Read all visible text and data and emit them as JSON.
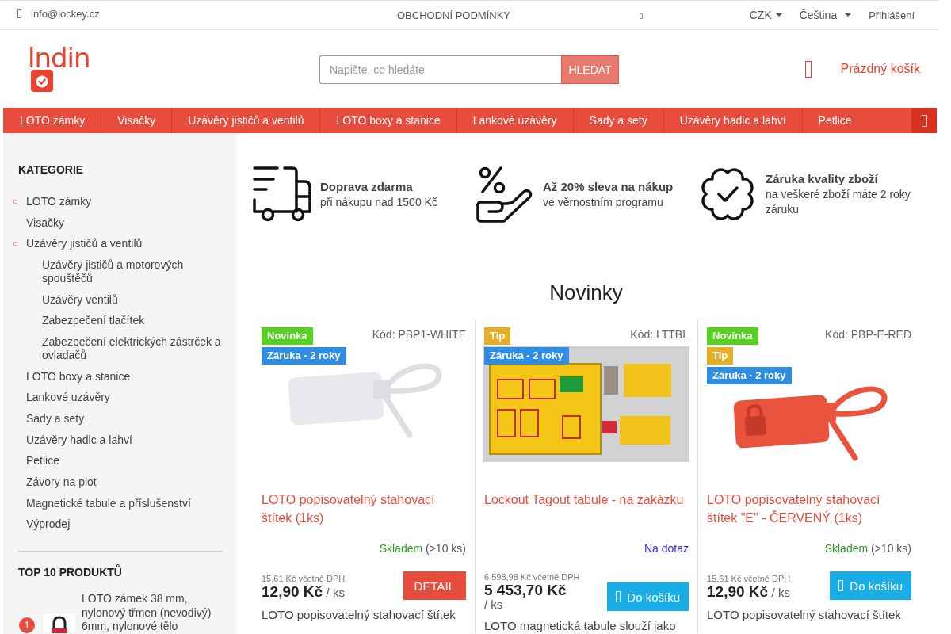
{
  "top_bar": {
    "email": "info@lockey.cz",
    "terms": "OBCHODNÍ PODMÍNKY",
    "currency": "CZK",
    "language": "Čeština",
    "login": "Přihlášení"
  },
  "header": {
    "logo": "lndin",
    "search": {
      "placeholder": "Napište, co hledáte",
      "button": "HLEDAT"
    },
    "cart": "Prázdný košík"
  },
  "nav": {
    "items": [
      "LOTO zámky",
      "Visačky",
      "Uzávěry jističů a ventilů",
      "LOTO boxy a stanice",
      "Lankové uzávěry",
      "Sady a sety",
      "Uzávěry hadic a lahví",
      "Petlice"
    ]
  },
  "sidebar": {
    "categories": {
      "title": "KATEGORIE",
      "items": [
        {
          "label": "LOTO zámky",
          "expandable": true
        },
        {
          "label": "Visačky",
          "expandable": false
        },
        {
          "label": "Uzávěry jističů a ventilů",
          "expandable": true,
          "children": [
            {
              "label": "Uzávěry jističů a motorových spouštěčů",
              "expandable": false
            },
            {
              "label": "Uzávěry ventilů",
              "expandable": false
            },
            {
              "label": "Zabezpečení tlačítek",
              "expandable": false
            },
            {
              "label": "Zabezpečení elektrických zástrček a ovladačů",
              "expandable": false
            }
          ]
        },
        {
          "label": "LOTO boxy a stanice",
          "expandable": false
        },
        {
          "label": "Lankové uzávěry",
          "expandable": false
        },
        {
          "label": "Sady a sety",
          "expandable": false
        },
        {
          "label": "Uzávěry hadic a lahví",
          "expandable": false
        },
        {
          "label": "Petlice",
          "expandable": false
        },
        {
          "label": "Závory na plot",
          "expandable": false
        },
        {
          "label": "Magnetické tabule a příslušenství",
          "expandable": false
        },
        {
          "label": "Výprodej",
          "expandable": false
        }
      ]
    },
    "top_products": {
      "title": "TOP 10 PRODUKTŮ",
      "items": [
        {
          "rank": "1",
          "name": "LOTO zámek 38 mm, nylonový třmen (nevodivý) 6mm, nylonové tělo"
        }
      ]
    }
  },
  "benefits": [
    {
      "kind": "truck",
      "title": "Doprava zdarma",
      "text": "při nákupu nad 1500 Kč"
    },
    {
      "kind": "discount",
      "title": "Až 20% sleva na nákup",
      "text": "ve věrnostním programu"
    },
    {
      "kind": "quality",
      "title": "Záruka kvality zboží",
      "text": "na veškeré zboží máte 2 roky záruku"
    }
  ],
  "new_products": {
    "title": "Novinky",
    "products": [
      {
        "kind": "whitetag",
        "badges": [
          {
            "kind": "new",
            "label": "Novinka"
          },
          {
            "kind": "warranty",
            "label": "Záruka - 2 roky"
          }
        ],
        "code": "Kód: PBP1-WHITE",
        "name": "LOTO popisovatelný stahovací štítek (1ks)",
        "stock": {
          "kind": "in_stock",
          "label": "Skladem",
          "quantity": "(>10 ks)"
        },
        "price_with_vat": "15,61 Kč včetně DPH",
        "price": "12,90 Kč",
        "unit": "/ ks",
        "button": {
          "kind": "detail",
          "label": "DETAIL"
        },
        "description": "LOTO popisovatelný stahovací štítek"
      },
      {
        "kind": "board",
        "badges": [
          {
            "kind": "tip",
            "label": "Tip"
          },
          {
            "kind": "warranty",
            "label": "Záruka - 2 roky"
          }
        ],
        "code": "Kód: LTTBL",
        "name": "Lockout Tagout tabule - na zakázku",
        "stock": {
          "kind": "on_request",
          "label": "Na dotaz"
        },
        "price_with_vat": "6 598,98 Kč včetně DPH",
        "price": "5 453,70 Kč",
        "unit": "/ ks",
        "button": {
          "kind": "cart",
          "label": "Do košíku"
        },
        "description": "LOTO magnetická tabule slouží jako"
      },
      {
        "kind": "redtag",
        "badges": [
          {
            "kind": "new",
            "label": "Novinka"
          },
          {
            "kind": "tip",
            "label": "Tip"
          },
          {
            "kind": "warranty",
            "label": "Záruka - 2 roky"
          }
        ],
        "code": "Kód: PBP-E-RED",
        "name": "LOTO popisovatelný stahovací štítek \"E\" - ČERVENÝ (1ks)",
        "stock": {
          "kind": "in_stock",
          "label": "Skladem",
          "quantity": "(>10 ks)"
        },
        "price_with_vat": "15,61 Kč včetně DPH",
        "price": "12,90 Kč",
        "unit": "/ ks",
        "button": {
          "kind": "cart",
          "label": "Do košíku"
        },
        "description": "LOTO popisovatelný stahovací štítek"
      }
    ]
  }
}
